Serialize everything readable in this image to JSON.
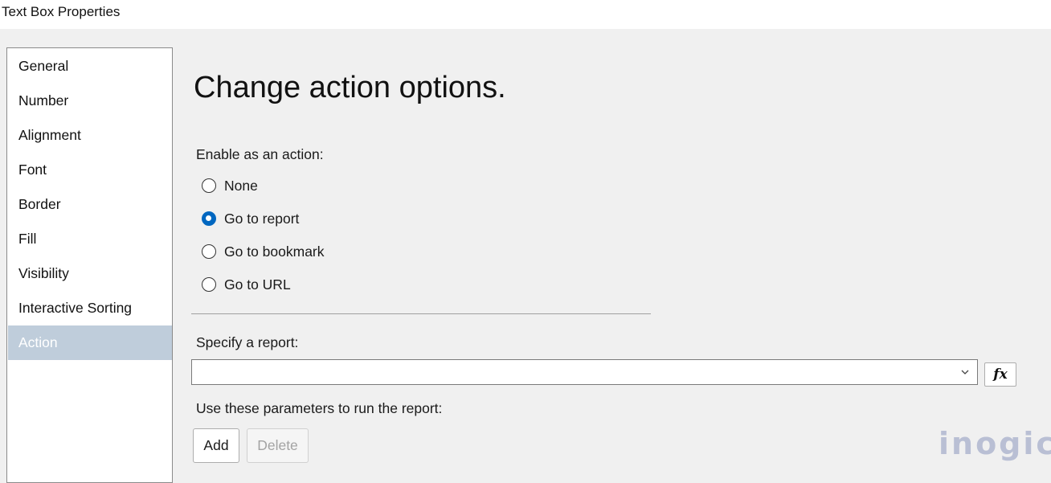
{
  "window": {
    "title": "Text Box Properties"
  },
  "nav": {
    "items": [
      {
        "label": "General"
      },
      {
        "label": "Number"
      },
      {
        "label": "Alignment"
      },
      {
        "label": "Font"
      },
      {
        "label": "Border"
      },
      {
        "label": "Fill"
      },
      {
        "label": "Visibility"
      },
      {
        "label": "Interactive Sorting"
      },
      {
        "label": "Action"
      }
    ],
    "selected": "Action",
    "selected_color": "#bfcddb"
  },
  "main": {
    "heading": "Change action options.",
    "enable_label": "Enable as an action:",
    "actions": [
      {
        "label": "None",
        "checked": false
      },
      {
        "label": "Go to report",
        "checked": true
      },
      {
        "label": "Go to bookmark",
        "checked": false
      },
      {
        "label": "Go to URL",
        "checked": false
      }
    ],
    "report_label": "Specify a report:",
    "report_value": "",
    "expression_button": "fx",
    "params_label": "Use these parameters to run the report:",
    "add_button": "Add",
    "delete_button": "Delete",
    "accent_color": "#0067c0"
  },
  "watermark": {
    "text": "inogic"
  },
  "icons": {
    "dropdown": "chevron-down-icon",
    "expression": "function-icon"
  }
}
